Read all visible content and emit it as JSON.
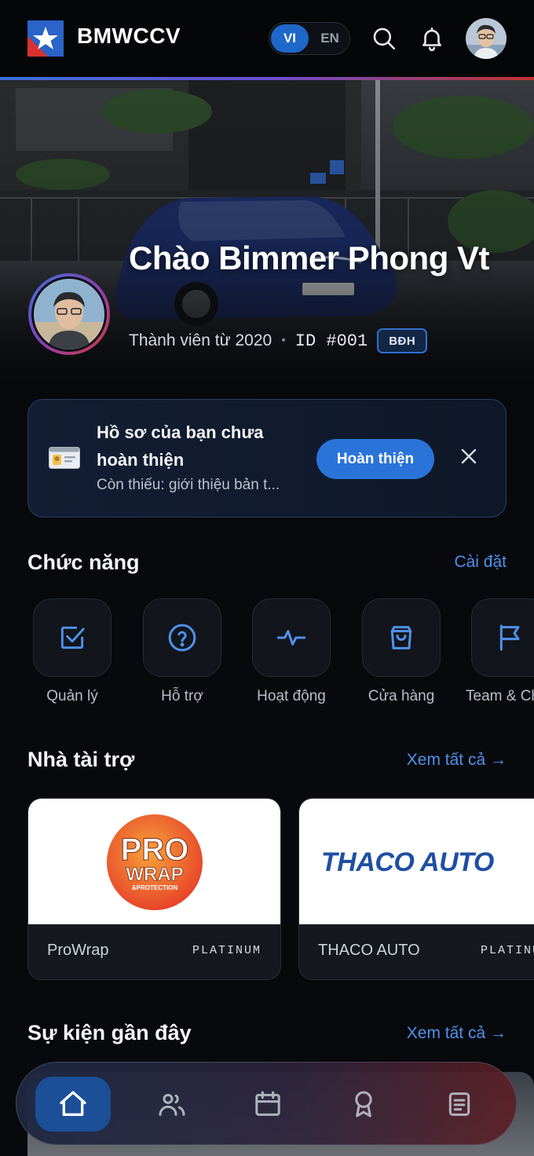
{
  "header": {
    "brand": "BMWCCV",
    "lang_vi": "VI",
    "lang_en": "EN",
    "icons": [
      "search-icon",
      "bell-icon"
    ]
  },
  "hero": {
    "greeting": "Chào Bimmer Phong Vt",
    "member_since": "Thành viên từ 2020",
    "separator": "•",
    "member_id": "ID #001",
    "role_badge": "BĐH"
  },
  "profile_banner": {
    "title": "Hồ sơ của bạn chưa hoàn thiện",
    "subtitle": "Còn thiếu: giới thiệu bản t...",
    "button": "Hoàn thiện"
  },
  "functions": {
    "title": "Chức năng",
    "link": "Cài đặt",
    "items": [
      {
        "label": "Quản lý",
        "icon": "checkbox-icon"
      },
      {
        "label": "Hỗ trợ",
        "icon": "help-icon"
      },
      {
        "label": "Hoạt động",
        "icon": "activity-icon"
      },
      {
        "label": "Cửa hàng",
        "icon": "shopping-bag-icon"
      },
      {
        "label": "Team & Ch",
        "icon": "flag-icon"
      }
    ]
  },
  "sponsors": {
    "title": "Nhà tài trợ",
    "link": "Xem tất cả →",
    "items": [
      {
        "name": "ProWrap",
        "tier": "PLATINUM",
        "logo_text_1": "PRO",
        "logo_text_2": "WRAP",
        "logo_text_3": "&PROTECTION"
      },
      {
        "name": "THACO AUTO",
        "tier": "PLATINUM",
        "logo_text_1": "THACO AUTO"
      }
    ]
  },
  "events": {
    "title": "Sự kiện gần đây",
    "link": "Xem tất cả →"
  },
  "bottom_nav": {
    "items": [
      "home-icon",
      "members-icon",
      "calendar-icon",
      "award-icon",
      "document-icon"
    ],
    "active": "home-icon"
  },
  "colors": {
    "accent_blue": "#2a73d9",
    "link_blue": "#4f92ec",
    "background": "#07090d"
  }
}
